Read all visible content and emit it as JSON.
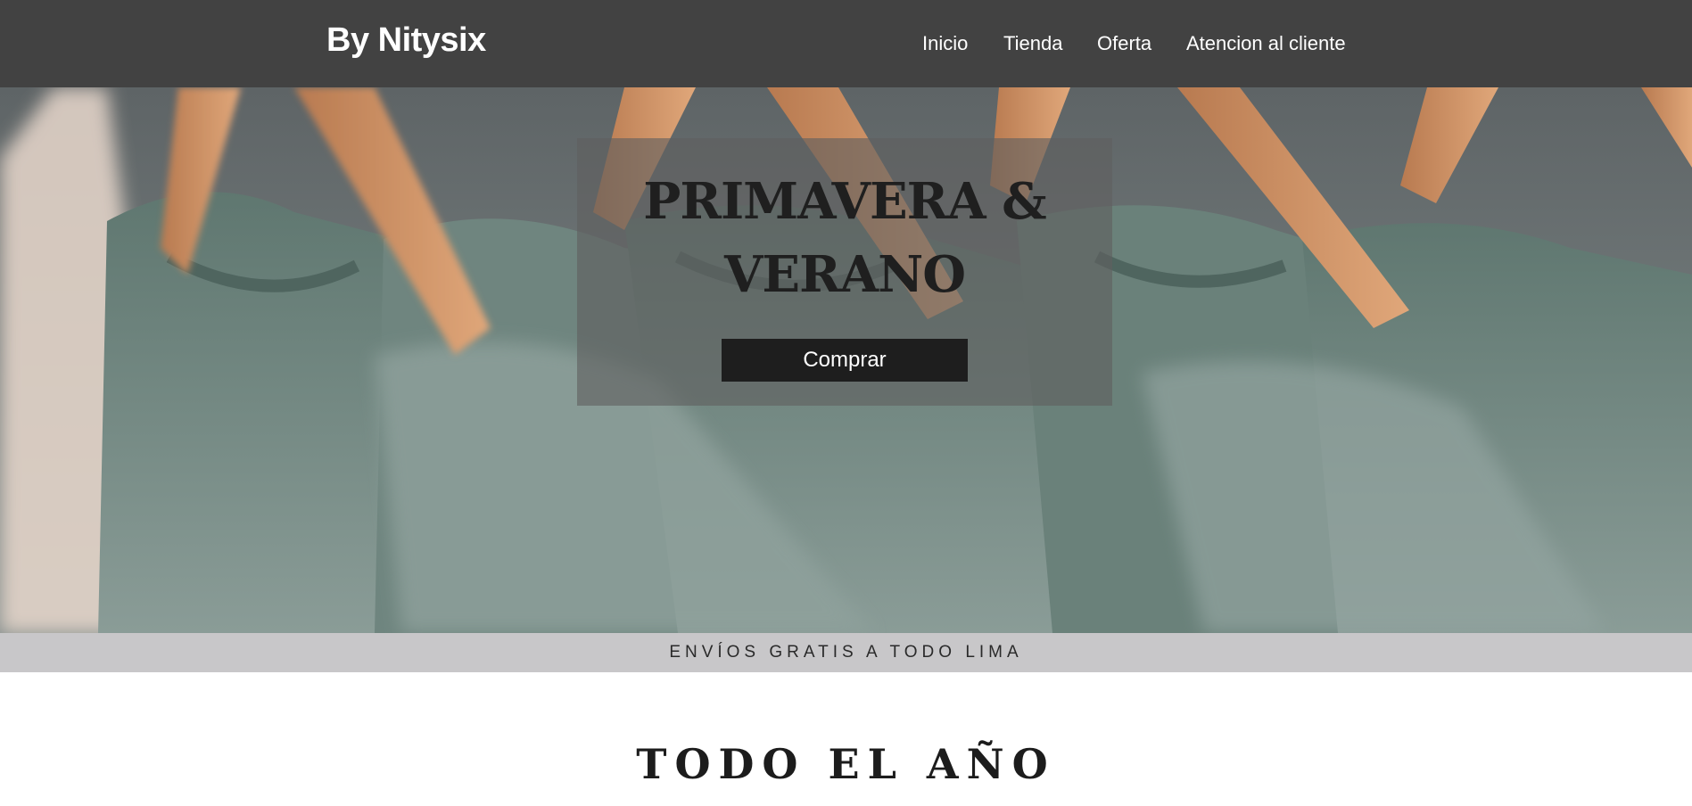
{
  "header": {
    "brand": "By Nitysix",
    "nav": [
      "Inicio",
      "Tienda",
      "Oferta",
      "Atencion al cliente"
    ]
  },
  "hero": {
    "title_line1": "PRIMAVERA &",
    "title_line2": "VERANO",
    "button_label": "Comprar",
    "image_subject": "green t-shirts hanging on wooden hangers"
  },
  "shipping_bar": {
    "text": "ENVÍOS GRATIS A TODO LIMA"
  },
  "section": {
    "title": "TODO EL AÑO"
  },
  "colors": {
    "header_bg": "#424242",
    "shirt_green": "#667d76",
    "hanger_wood": "#c98a5e",
    "shipbar_bg": "#c8c7c9",
    "button_bg": "#1e1e1e"
  }
}
